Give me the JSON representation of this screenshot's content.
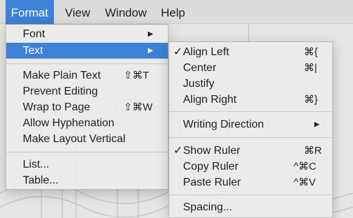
{
  "menubar": {
    "items": [
      {
        "label": "Format"
      },
      {
        "label": "View"
      },
      {
        "label": "Window"
      },
      {
        "label": "Help"
      }
    ]
  },
  "format_menu": {
    "items": [
      {
        "label": "Font"
      },
      {
        "label": "Text"
      },
      {
        "label": "Make Plain Text",
        "shortcut": "⇧⌘T"
      },
      {
        "label": "Prevent Editing"
      },
      {
        "label": "Wrap to Page",
        "shortcut": "⇧⌘W"
      },
      {
        "label": "Allow Hyphenation"
      },
      {
        "label": "Make Layout Vertical"
      },
      {
        "label": "List..."
      },
      {
        "label": "Table..."
      }
    ]
  },
  "text_submenu": {
    "items": [
      {
        "label": "Align Left",
        "shortcut": "⌘{",
        "checked": true
      },
      {
        "label": "Center",
        "shortcut": "⌘|"
      },
      {
        "label": "Justify"
      },
      {
        "label": "Align Right",
        "shortcut": "⌘}"
      },
      {
        "label": "Writing Direction"
      },
      {
        "label": "Show Ruler",
        "shortcut": "⌘R",
        "checked": true
      },
      {
        "label": "Copy Ruler",
        "shortcut": "^⌘C"
      },
      {
        "label": "Paste Ruler",
        "shortcut": "^⌘V"
      },
      {
        "label": "Spacing..."
      }
    ]
  },
  "icons": {
    "submenu_arrow": "▶",
    "checkmark": "✓"
  },
  "colors": {
    "selection": "#3d82d6",
    "menu_background": "#ececea",
    "text": "#1e1e1e"
  }
}
